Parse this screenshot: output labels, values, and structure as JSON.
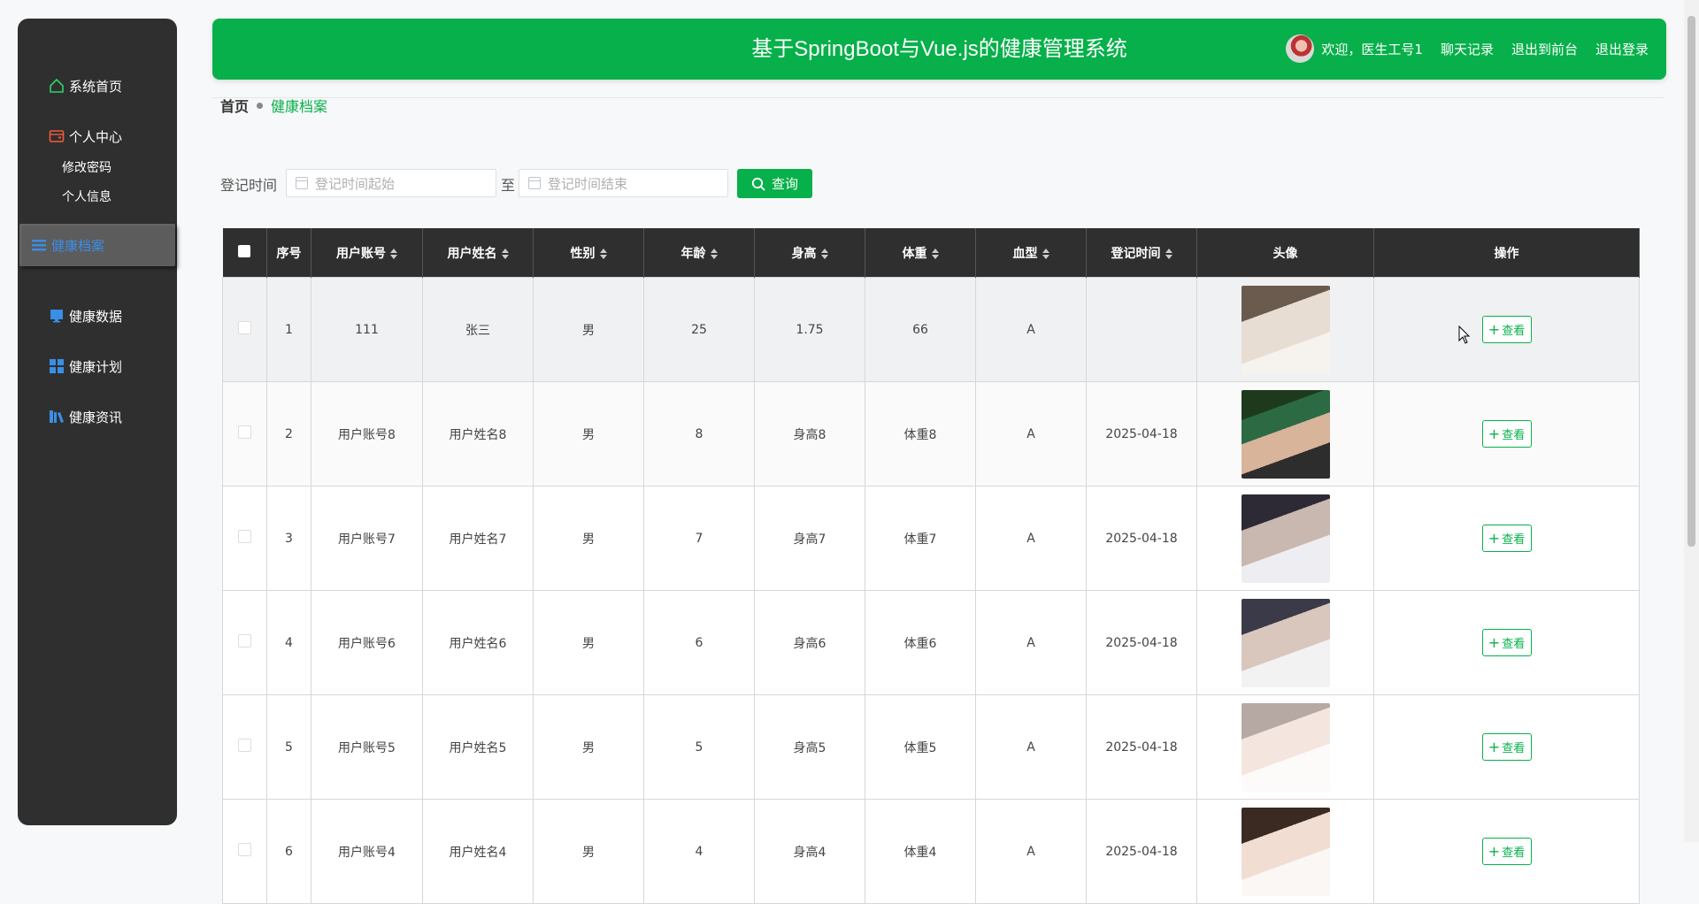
{
  "sidebar": {
    "home": "系统首页",
    "personal": "个人中心",
    "change_password": "修改密码",
    "personal_info": "个人信息",
    "health_records": "健康档案",
    "health_data": "健康数据",
    "health_plan": "健康计划",
    "health_news": "健康资讯"
  },
  "header": {
    "title": "基于SpringBoot与Vue.js的健康管理系统",
    "welcome": "欢迎，医生工号1",
    "chat": "聊天记录",
    "front": "退出到前台",
    "logout": "退出登录"
  },
  "breadcrumb": {
    "home": "首页",
    "current": "健康档案"
  },
  "search": {
    "label": "登记时间",
    "start_placeholder": "登记时间起始",
    "to": "至",
    "end_placeholder": "登记时间结束",
    "query": "查询"
  },
  "table": {
    "headers": {
      "index": "序号",
      "account": "用户账号",
      "name": "用户姓名",
      "gender": "性别",
      "age": "年龄",
      "height": "身高",
      "weight": "体重",
      "blood": "血型",
      "date": "登记时间",
      "avatar": "头像",
      "ops": "操作"
    },
    "view_label": "查看",
    "rows": [
      {
        "index": "1",
        "account": "111",
        "name": "张三",
        "gender": "男",
        "age": "25",
        "height": "1.75",
        "weight": "66",
        "blood": "A",
        "date": ""
      },
      {
        "index": "2",
        "account": "用户账号8",
        "name": "用户姓名8",
        "gender": "男",
        "age": "8",
        "height": "身高8",
        "weight": "体重8",
        "blood": "A",
        "date": "2025-04-18"
      },
      {
        "index": "3",
        "account": "用户账号7",
        "name": "用户姓名7",
        "gender": "男",
        "age": "7",
        "height": "身高7",
        "weight": "体重7",
        "blood": "A",
        "date": "2025-04-18"
      },
      {
        "index": "4",
        "account": "用户账号6",
        "name": "用户姓名6",
        "gender": "男",
        "age": "6",
        "height": "身高6",
        "weight": "体重6",
        "blood": "A",
        "date": "2025-04-18"
      },
      {
        "index": "5",
        "account": "用户账号5",
        "name": "用户姓名5",
        "gender": "男",
        "age": "5",
        "height": "身高5",
        "weight": "体重5",
        "blood": "A",
        "date": "2025-04-18"
      },
      {
        "index": "6",
        "account": "用户账号4",
        "name": "用户姓名4",
        "gender": "男",
        "age": "4",
        "height": "身高4",
        "weight": "体重4",
        "blood": "A",
        "date": "2025-04-18"
      }
    ]
  },
  "colors": {
    "primary": "#07b04a",
    "sidebar": "#2f2f2f",
    "active_text": "#3a8ee6"
  }
}
